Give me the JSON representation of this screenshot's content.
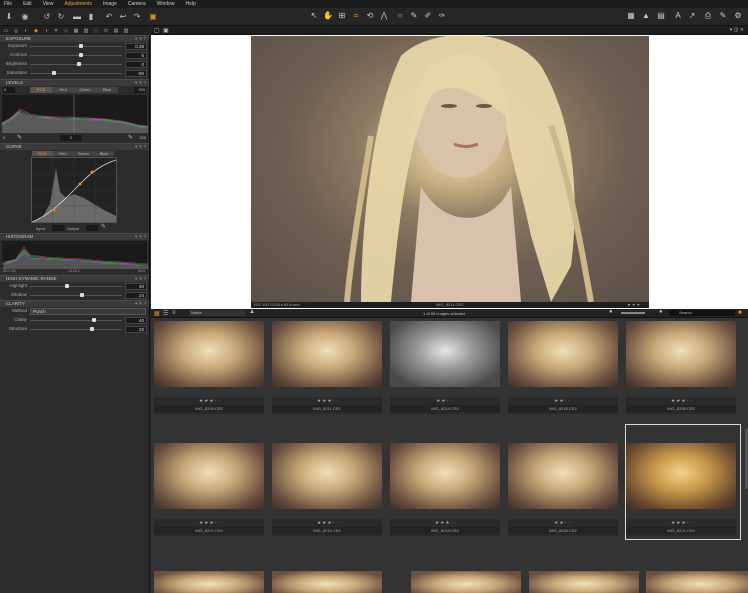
{
  "menu": [
    "File",
    "Edit",
    "View",
    "Adjustments",
    "Image",
    "Camera",
    "Window",
    "Help"
  ],
  "menu_active": "Adjustments",
  "panels": {
    "exposure": {
      "title": "EXPOSURE",
      "rows": [
        {
          "label": "Exposure",
          "value": "0.38",
          "knob": 0.55
        },
        {
          "label": "Contrast",
          "value": "5",
          "knob": 0.55
        },
        {
          "label": "Brightness",
          "value": "0",
          "knob": 0.53
        },
        {
          "label": "Saturation",
          "value": "-50",
          "knob": 0.26
        }
      ]
    },
    "levels": {
      "title": "LEVELS",
      "left": "0",
      "right": "255",
      "tabs": [
        "RGB",
        "Red",
        "Green",
        "Blue"
      ],
      "in": "0",
      "mid": "0",
      "out": "255"
    },
    "curve": {
      "title": "CURVE",
      "tabs": [
        "RGB",
        "Red",
        "Green",
        "Blue"
      ],
      "input_label": "Input",
      "output_label": "Output"
    },
    "histogram": {
      "title": "HISTOGRAM",
      "info": [
        "ISO 100",
        "1/125 s",
        "f/5.6"
      ]
    },
    "hdr": {
      "title": "HIGH DYNAMIC RANGE",
      "rows": [
        {
          "label": "Highlight",
          "value": "40",
          "knob": 0.4
        },
        {
          "label": "Shadow",
          "value": "24",
          "knob": 0.56
        }
      ]
    },
    "clarity": {
      "title": "CLARITY",
      "method_label": "Method",
      "method": "Punch",
      "rows": [
        {
          "label": "Clarity",
          "value": "40",
          "knob": 0.7
        },
        {
          "label": "Structure",
          "value": "22",
          "knob": 0.67
        }
      ]
    }
  },
  "viewer": {
    "info_left": "ISO 100 1/125 s f/5.6 mm",
    "filename": "IMG_8211.CR2"
  },
  "browser": {
    "sort_label": "Name",
    "status": "1 of 55 images selected",
    "search_placeholder": "Search"
  },
  "thumbs": [
    {
      "file": "IMG_8209.CR2",
      "stars": "★ ★ ★ · ·",
      "gray": false,
      "warm": false
    },
    {
      "file": "IMG_8211.CR2",
      "stars": "★ ★ ★ · ·",
      "gray": false,
      "warm": false
    },
    {
      "file": "IMG_8214.CR2",
      "stars": "★ ★ · · ·",
      "gray": true,
      "warm": false
    },
    {
      "file": "IMG_8218.CR2",
      "stars": "★ ★ · · ·",
      "gray": false,
      "warm": false
    },
    {
      "file": "IMG_8255.CR2",
      "stars": "★ ★ ★ · ·",
      "gray": false,
      "warm": false
    },
    {
      "file": "IMG_8207.CR2",
      "stars": "★ ★ ★ · ·",
      "gray": false,
      "warm": false
    },
    {
      "file": "IMG_8216.CR2",
      "stars": "★ ★ ★ · ·",
      "gray": false,
      "warm": false
    },
    {
      "file": "IMG_8219.CR2",
      "stars": "★ ★ ★ · ·",
      "gray": false,
      "warm": false
    },
    {
      "file": "IMG_8228.CR2",
      "stars": "★ ★ · · ·",
      "gray": false,
      "warm": false
    },
    {
      "file": "IMG_8221.CR2",
      "stars": "★ ★ ★ · ·",
      "gray": false,
      "warm": true
    }
  ],
  "colors": {
    "accent": "#e08a2a"
  }
}
